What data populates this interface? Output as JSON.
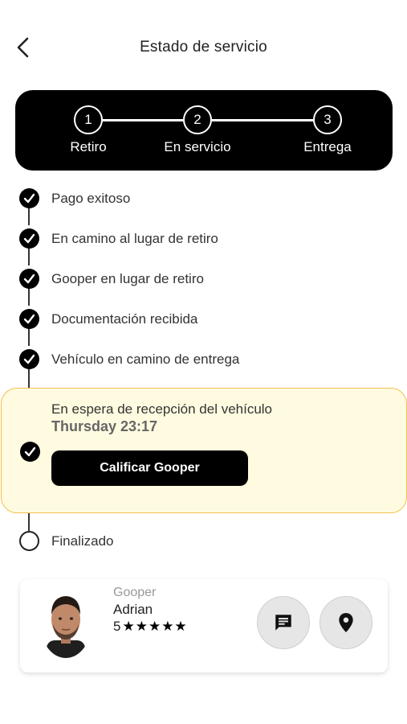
{
  "header": {
    "title": "Estado de servicio"
  },
  "stepper": {
    "steps": [
      {
        "number": "1",
        "label": "Retiro"
      },
      {
        "number": "2",
        "label": "En servicio"
      },
      {
        "number": "3",
        "label": "Entrega"
      }
    ]
  },
  "timeline": {
    "completed": [
      "Pago exitoso",
      "En camino al lugar de retiro",
      "Gooper en lugar de retiro",
      "Documentación recibida",
      "Vehículo en camino de entrega"
    ],
    "current": {
      "title": "En espera de recepción del vehículo",
      "time": "Thursday 23:17",
      "button_label": "Calificar Gooper"
    },
    "final": "Finalizado"
  },
  "driver": {
    "role": "Gooper",
    "name": "Adrian",
    "rating": "5",
    "stars": "★★★★★"
  },
  "icons": {
    "back": "chevron-left-icon",
    "check": "check-icon",
    "chat": "chat-icon",
    "location": "location-pin-icon"
  },
  "colors": {
    "accent_card_bg": "#fffbe0",
    "accent_card_border": "#f2c14e",
    "stepper_bg": "#000000"
  }
}
